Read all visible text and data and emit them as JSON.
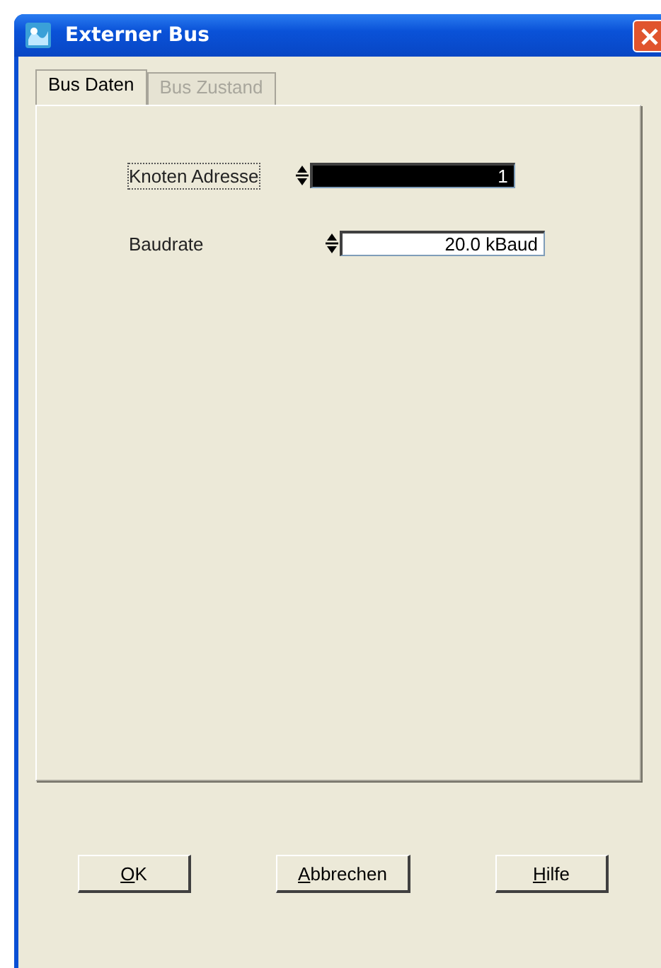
{
  "window": {
    "title": "Externer Bus"
  },
  "tabs": [
    {
      "label": "Bus Daten",
      "selected": true,
      "disabled": false
    },
    {
      "label": "Bus Zustand",
      "selected": false,
      "disabled": true
    }
  ],
  "fields": [
    {
      "label": "Knoten Adresse",
      "focused": true,
      "value": "1",
      "selected": true
    },
    {
      "label": "Baudrate",
      "focused": false,
      "value": "20.0 kBaud",
      "selected": false
    }
  ],
  "buttons": [
    {
      "label": "OK",
      "mnemonic": true
    },
    {
      "label": "Abbrechen",
      "mnemonic": true
    },
    {
      "label": "Hilfe",
      "mnemonic": true
    }
  ]
}
